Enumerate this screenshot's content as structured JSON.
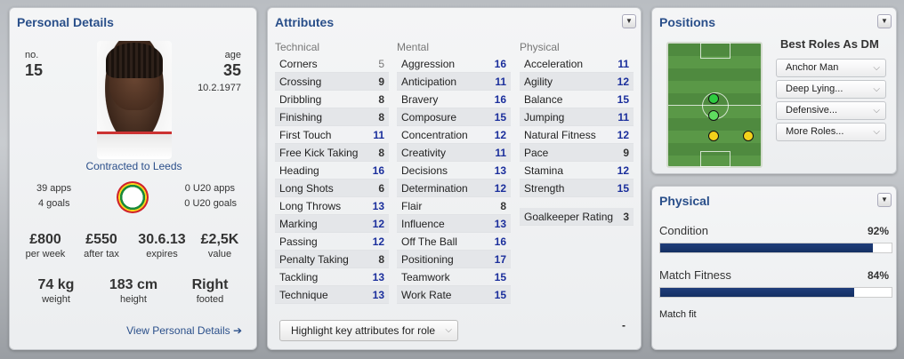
{
  "personal": {
    "title": "Personal Details",
    "no_label": "no.",
    "no": "15",
    "age_label": "age",
    "age": "35",
    "dob": "10.2.1977",
    "contract": "Contracted to Leeds",
    "apps": "39 apps",
    "goals": "4 goals",
    "u20_apps": "0 U20 apps",
    "u20_goals": "0 U20 goals",
    "wage": "£800",
    "wage_label": "per week",
    "after_tax": "£550",
    "after_tax_label": "after tax",
    "expires": "30.6.13",
    "expires_label": "expires",
    "value": "£2,5K",
    "value_label": "value",
    "weight": "74 kg",
    "weight_label": "weight",
    "height": "183 cm",
    "height_label": "height",
    "footed": "Right",
    "footed_label": "footed",
    "link": "View Personal Details ➔"
  },
  "attributes": {
    "title": "Attributes",
    "technical_label": "Technical",
    "mental_label": "Mental",
    "physical_label": "Physical",
    "technical": [
      {
        "name": "Corners",
        "value": "5"
      },
      {
        "name": "Crossing",
        "value": "9"
      },
      {
        "name": "Dribbling",
        "value": "8"
      },
      {
        "name": "Finishing",
        "value": "8"
      },
      {
        "name": "First Touch",
        "value": "11"
      },
      {
        "name": "Free Kick Taking",
        "value": "8"
      },
      {
        "name": "Heading",
        "value": "16"
      },
      {
        "name": "Long Shots",
        "value": "6"
      },
      {
        "name": "Long Throws",
        "value": "13"
      },
      {
        "name": "Marking",
        "value": "12"
      },
      {
        "name": "Passing",
        "value": "12"
      },
      {
        "name": "Penalty Taking",
        "value": "8"
      },
      {
        "name": "Tackling",
        "value": "13"
      },
      {
        "name": "Technique",
        "value": "13"
      }
    ],
    "mental": [
      {
        "name": "Aggression",
        "value": "16"
      },
      {
        "name": "Anticipation",
        "value": "11"
      },
      {
        "name": "Bravery",
        "value": "16"
      },
      {
        "name": "Composure",
        "value": "15"
      },
      {
        "name": "Concentration",
        "value": "12"
      },
      {
        "name": "Creativity",
        "value": "11"
      },
      {
        "name": "Decisions",
        "value": "13"
      },
      {
        "name": "Determination",
        "value": "12"
      },
      {
        "name": "Flair",
        "value": "8"
      },
      {
        "name": "Influence",
        "value": "13"
      },
      {
        "name": "Off The Ball",
        "value": "16"
      },
      {
        "name": "Positioning",
        "value": "17"
      },
      {
        "name": "Teamwork",
        "value": "15"
      },
      {
        "name": "Work Rate",
        "value": "15"
      }
    ],
    "physical": [
      {
        "name": "Acceleration",
        "value": "11"
      },
      {
        "name": "Agility",
        "value": "12"
      },
      {
        "name": "Balance",
        "value": "15"
      },
      {
        "name": "Jumping",
        "value": "11"
      },
      {
        "name": "Natural Fitness",
        "value": "12"
      },
      {
        "name": "Pace",
        "value": "9"
      },
      {
        "name": "Stamina",
        "value": "12"
      },
      {
        "name": "Strength",
        "value": "15"
      }
    ],
    "gk_label": "Goalkeeper Rating",
    "gk_value": "3",
    "highlight_btn": "Highlight key attributes for role",
    "dash": "-"
  },
  "positions": {
    "title": "Positions",
    "best_roles": "Best Roles As DM",
    "roles": [
      "Anchor Man",
      "Deep Lying...",
      "Defensive...",
      "More Roles..."
    ],
    "colors": {
      "natural": "#2ecc40",
      "accomplished": "#f2d21b"
    }
  },
  "physical_panel": {
    "title": "Physical",
    "condition_label": "Condition",
    "condition": "92%",
    "condition_frac": 0.92,
    "fitness_label": "Match Fitness",
    "fitness": "84%",
    "fitness_frac": 0.84,
    "match_fit": "Match fit"
  }
}
